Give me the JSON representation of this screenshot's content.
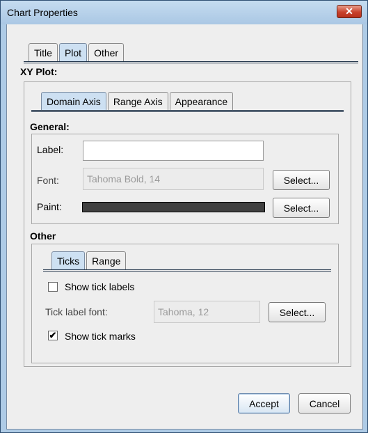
{
  "window": {
    "title": "Chart Properties",
    "close_symbol": "✕"
  },
  "top_tabs": [
    "Title",
    "Plot",
    "Other"
  ],
  "xy_plot": {
    "heading": "XY Plot:",
    "tabs": [
      "Domain Axis",
      "Range Axis",
      "Appearance"
    ]
  },
  "general": {
    "heading": "General:",
    "label_label": "Label:",
    "label_value": "",
    "font_label": "Font:",
    "font_value": "Tahoma Bold, 14",
    "font_select": "Select...",
    "paint_label": "Paint:",
    "paint_color": "#404040",
    "paint_select": "Select..."
  },
  "other": {
    "heading": "Other",
    "tabs": [
      "Ticks",
      "Range"
    ],
    "show_tick_labels": {
      "label": "Show tick labels",
      "checked": false
    },
    "tick_label_font_label": "Tick label font:",
    "tick_label_font_value": "Tahoma, 12",
    "tick_font_select": "Select...",
    "show_tick_marks": {
      "label": "Show tick marks",
      "checked": true,
      "mark": "✔"
    }
  },
  "buttons": {
    "accept": "Accept",
    "cancel": "Cancel"
  }
}
